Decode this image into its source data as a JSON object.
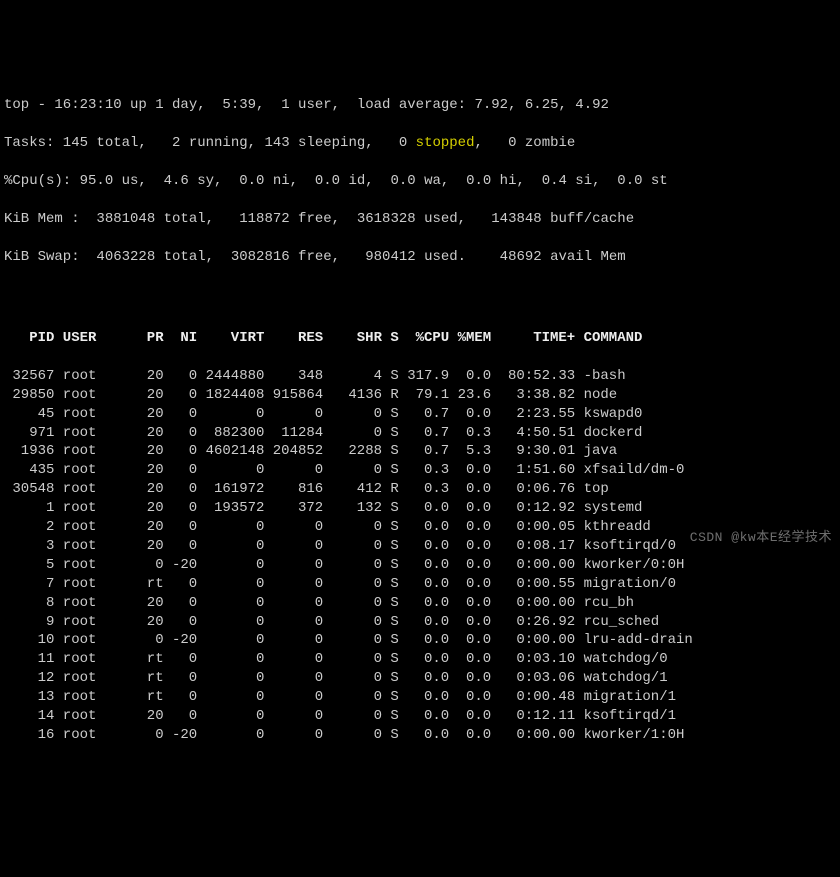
{
  "summary": {
    "line1": "top - 16:23:10 up 1 day,  5:39,  1 user,  load average: 7.92, 6.25, 4.92",
    "tasks_pre": "Tasks: 145 total,   2 running, 143 sleeping,   0 ",
    "tasks_stopped": "stopped",
    "tasks_post": ",   0 zombie",
    "cpu": "%Cpu(s): 95.0 us,  4.6 sy,  0.0 ni,  0.0 id,  0.0 wa,  0.0 hi,  0.4 si,  0.0 st",
    "mem": "KiB Mem :  3881048 total,   118872 free,  3618328 used,   143848 buff/cache",
    "swap": "KiB Swap:  4063228 total,  3082816 free,   980412 used.    48692 avail Mem"
  },
  "columns": [
    "PID",
    "USER",
    "PR",
    "NI",
    "VIRT",
    "RES",
    "SHR",
    "S",
    "%CPU",
    "%MEM",
    "TIME+",
    "COMMAND"
  ],
  "processes": [
    {
      "pid": "32567",
      "user": "root",
      "pr": "20",
      "ni": "0",
      "virt": "2444880",
      "res": "348",
      "shr": "4",
      "s": "S",
      "cpu": "317.9",
      "mem": "0.0",
      "time": "80:52.33",
      "cmd": "-bash"
    },
    {
      "pid": "29850",
      "user": "root",
      "pr": "20",
      "ni": "0",
      "virt": "1824408",
      "res": "915864",
      "shr": "4136",
      "s": "R",
      "cpu": "79.1",
      "mem": "23.6",
      "time": "3:38.82",
      "cmd": "node"
    },
    {
      "pid": "45",
      "user": "root",
      "pr": "20",
      "ni": "0",
      "virt": "0",
      "res": "0",
      "shr": "0",
      "s": "S",
      "cpu": "0.7",
      "mem": "0.0",
      "time": "2:23.55",
      "cmd": "kswapd0"
    },
    {
      "pid": "971",
      "user": "root",
      "pr": "20",
      "ni": "0",
      "virt": "882300",
      "res": "11284",
      "shr": "0",
      "s": "S",
      "cpu": "0.7",
      "mem": "0.3",
      "time": "4:50.51",
      "cmd": "dockerd"
    },
    {
      "pid": "1936",
      "user": "root",
      "pr": "20",
      "ni": "0",
      "virt": "4602148",
      "res": "204852",
      "shr": "2288",
      "s": "S",
      "cpu": "0.7",
      "mem": "5.3",
      "time": "9:30.01",
      "cmd": "java"
    },
    {
      "pid": "435",
      "user": "root",
      "pr": "20",
      "ni": "0",
      "virt": "0",
      "res": "0",
      "shr": "0",
      "s": "S",
      "cpu": "0.3",
      "mem": "0.0",
      "time": "1:51.60",
      "cmd": "xfsaild/dm-0"
    },
    {
      "pid": "30548",
      "user": "root",
      "pr": "20",
      "ni": "0",
      "virt": "161972",
      "res": "816",
      "shr": "412",
      "s": "R",
      "cpu": "0.3",
      "mem": "0.0",
      "time": "0:06.76",
      "cmd": "top"
    },
    {
      "pid": "1",
      "user": "root",
      "pr": "20",
      "ni": "0",
      "virt": "193572",
      "res": "372",
      "shr": "132",
      "s": "S",
      "cpu": "0.0",
      "mem": "0.0",
      "time": "0:12.92",
      "cmd": "systemd"
    },
    {
      "pid": "2",
      "user": "root",
      "pr": "20",
      "ni": "0",
      "virt": "0",
      "res": "0",
      "shr": "0",
      "s": "S",
      "cpu": "0.0",
      "mem": "0.0",
      "time": "0:00.05",
      "cmd": "kthreadd"
    },
    {
      "pid": "3",
      "user": "root",
      "pr": "20",
      "ni": "0",
      "virt": "0",
      "res": "0",
      "shr": "0",
      "s": "S",
      "cpu": "0.0",
      "mem": "0.0",
      "time": "0:08.17",
      "cmd": "ksoftirqd/0"
    },
    {
      "pid": "5",
      "user": "root",
      "pr": "0",
      "ni": "-20",
      "virt": "0",
      "res": "0",
      "shr": "0",
      "s": "S",
      "cpu": "0.0",
      "mem": "0.0",
      "time": "0:00.00",
      "cmd": "kworker/0:0H"
    },
    {
      "pid": "7",
      "user": "root",
      "pr": "rt",
      "ni": "0",
      "virt": "0",
      "res": "0",
      "shr": "0",
      "s": "S",
      "cpu": "0.0",
      "mem": "0.0",
      "time": "0:00.55",
      "cmd": "migration/0"
    },
    {
      "pid": "8",
      "user": "root",
      "pr": "20",
      "ni": "0",
      "virt": "0",
      "res": "0",
      "shr": "0",
      "s": "S",
      "cpu": "0.0",
      "mem": "0.0",
      "time": "0:00.00",
      "cmd": "rcu_bh"
    },
    {
      "pid": "9",
      "user": "root",
      "pr": "20",
      "ni": "0",
      "virt": "0",
      "res": "0",
      "shr": "0",
      "s": "S",
      "cpu": "0.0",
      "mem": "0.0",
      "time": "0:26.92",
      "cmd": "rcu_sched"
    },
    {
      "pid": "10",
      "user": "root",
      "pr": "0",
      "ni": "-20",
      "virt": "0",
      "res": "0",
      "shr": "0",
      "s": "S",
      "cpu": "0.0",
      "mem": "0.0",
      "time": "0:00.00",
      "cmd": "lru-add-drain"
    },
    {
      "pid": "11",
      "user": "root",
      "pr": "rt",
      "ni": "0",
      "virt": "0",
      "res": "0",
      "shr": "0",
      "s": "S",
      "cpu": "0.0",
      "mem": "0.0",
      "time": "0:03.10",
      "cmd": "watchdog/0"
    },
    {
      "pid": "12",
      "user": "root",
      "pr": "rt",
      "ni": "0",
      "virt": "0",
      "res": "0",
      "shr": "0",
      "s": "S",
      "cpu": "0.0",
      "mem": "0.0",
      "time": "0:03.06",
      "cmd": "watchdog/1"
    },
    {
      "pid": "13",
      "user": "root",
      "pr": "rt",
      "ni": "0",
      "virt": "0",
      "res": "0",
      "shr": "0",
      "s": "S",
      "cpu": "0.0",
      "mem": "0.0",
      "time": "0:00.48",
      "cmd": "migration/1"
    },
    {
      "pid": "14",
      "user": "root",
      "pr": "20",
      "ni": "0",
      "virt": "0",
      "res": "0",
      "shr": "0",
      "s": "S",
      "cpu": "0.0",
      "mem": "0.0",
      "time": "0:12.11",
      "cmd": "ksoftirqd/1"
    },
    {
      "pid": "16",
      "user": "root",
      "pr": "0",
      "ni": "-20",
      "virt": "0",
      "res": "0",
      "shr": "0",
      "s": "S",
      "cpu": "0.0",
      "mem": "0.0",
      "time": "0:00.00",
      "cmd": "kworker/1:0H"
    }
  ],
  "watermark": "CSDN @kw本E经学技术"
}
